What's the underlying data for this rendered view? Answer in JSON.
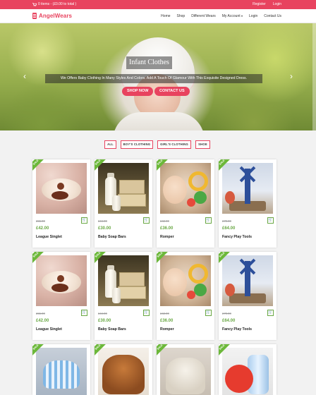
{
  "topbar": {
    "cart_text": "0 items - (£0.00 to total )",
    "links": [
      "Register",
      "Login"
    ]
  },
  "nav": {
    "logo": "AngelWears",
    "menu": [
      "Home",
      "Shop",
      "Different Wears",
      "My Account",
      "Login",
      "Contact Us"
    ]
  },
  "hero": {
    "title": "Infant Clothes",
    "subtitle": "We Offers Baby Clothing In Many Styles And Colors. Add A Touch Of Glamour With This Exquisite Designed Dress.",
    "shop_label": "SHOP NOW",
    "contact_label": "CONTACT US",
    "prev_label": "‹",
    "next_label": "›"
  },
  "filters": [
    "ALL",
    "BOY'S CLOTHING",
    "GIRL'S CLOTHING",
    "SHOE"
  ],
  "products": [
    {
      "ribbon": "SALE",
      "old": "£55.00",
      "price": "£42.00",
      "name": "League Singlet"
    },
    {
      "ribbon": "SALE",
      "old": "£44.00",
      "price": "£30.00",
      "name": "Baby Soap Bars"
    },
    {
      "ribbon": "SALE",
      "old": "£42.00",
      "price": "£36.00",
      "name": "Romper"
    },
    {
      "ribbon": "SALE",
      "old": "£70.00",
      "price": "£64.00",
      "name": "Fancy Play Tools"
    },
    {
      "ribbon": "SALE",
      "old": "£55.00",
      "price": "£42.00",
      "name": "League Singlet"
    },
    {
      "ribbon": "SALE",
      "old": "£44.00",
      "price": "£30.00",
      "name": "Baby Soap Bars"
    },
    {
      "ribbon": "SALE",
      "old": "£42.00",
      "price": "£36.00",
      "name": "Romper"
    },
    {
      "ribbon": "SALE",
      "old": "£70.00",
      "price": "£64.00",
      "name": "Fancy Play Tools"
    },
    {
      "ribbon": "SALE"
    },
    {
      "ribbon": "SALE"
    },
    {
      "ribbon": "SALE"
    },
    {
      "ribbon": "SALE"
    }
  ],
  "colors": {
    "accent": "#e8435f",
    "price": "#6aa845",
    "ribbon": "#6cb83a"
  },
  "icons": {
    "cart": "shopping-cart-icon",
    "add_to_cart": "cart-icon"
  }
}
